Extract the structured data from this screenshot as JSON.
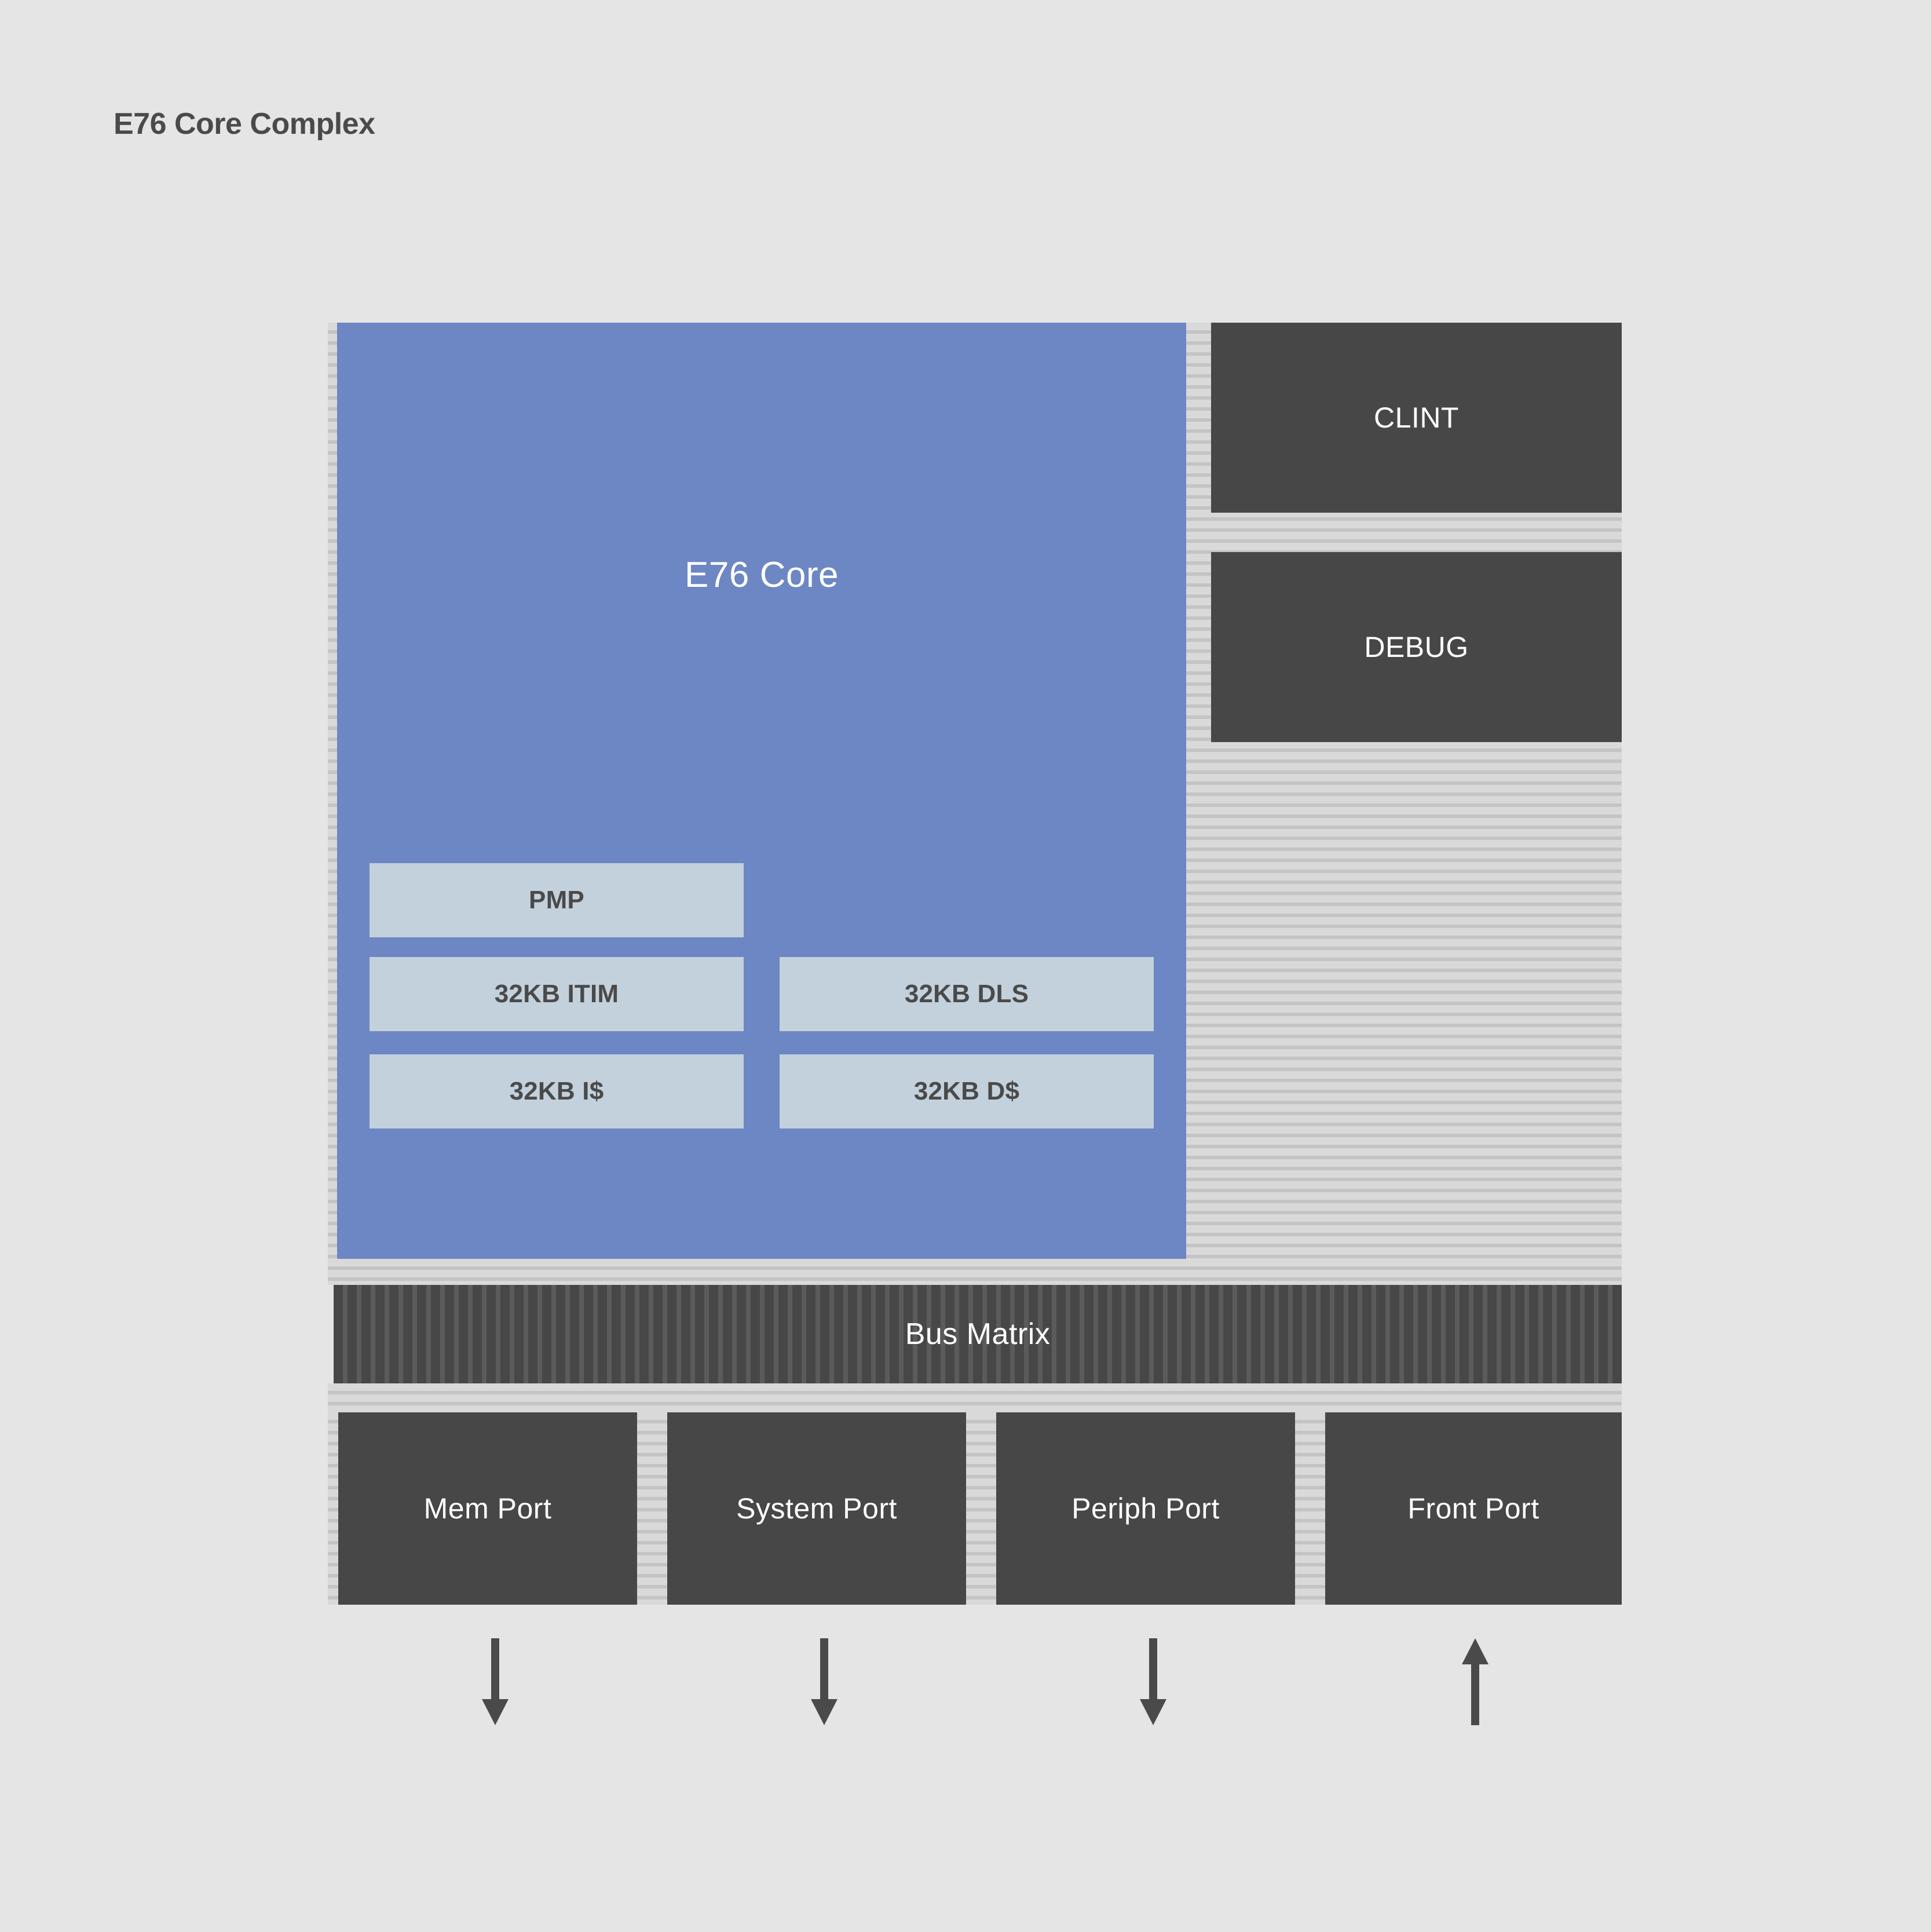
{
  "title": "E76 Core Complex",
  "colors": {
    "background": "#e5e5e5",
    "core_blue": "#6d86c4",
    "core_sub_fill": "#c3d1dc",
    "dark_block": "#474747",
    "text_dark": "#4a4a4a",
    "text_light": "#ffffff",
    "hatch_light": "#d9d9d9",
    "hatch_line": "#c4c4c4"
  },
  "core": {
    "label": "E76 Core",
    "sub_blocks": [
      {
        "id": "pmp",
        "label": "PMP"
      },
      {
        "id": "itim",
        "label": "32KB ITIM"
      },
      {
        "id": "dls",
        "label": "32KB DLS"
      },
      {
        "id": "icache",
        "label": "32KB I$"
      },
      {
        "id": "dcache",
        "label": "32KB D$"
      }
    ]
  },
  "side_blocks": [
    {
      "id": "clint",
      "label": "CLINT"
    },
    {
      "id": "debug",
      "label": "DEBUG"
    }
  ],
  "bus": {
    "label": "Bus Matrix"
  },
  "ports": [
    {
      "id": "mem",
      "label": "Mem Port",
      "arrow": "down"
    },
    {
      "id": "system",
      "label": "System Port",
      "arrow": "down"
    },
    {
      "id": "periph",
      "label": "Periph Port",
      "arrow": "down"
    },
    {
      "id": "front",
      "label": "Front Port",
      "arrow": "up"
    }
  ],
  "arrows": [
    {
      "id": "mem-arrow",
      "direction": "down",
      "glyph": "arrow-down-icon"
    },
    {
      "id": "system-arrow",
      "direction": "down",
      "glyph": "arrow-down-icon"
    },
    {
      "id": "periph-arrow",
      "direction": "down",
      "glyph": "arrow-down-icon"
    },
    {
      "id": "front-arrow",
      "direction": "up",
      "glyph": "arrow-up-icon"
    }
  ]
}
